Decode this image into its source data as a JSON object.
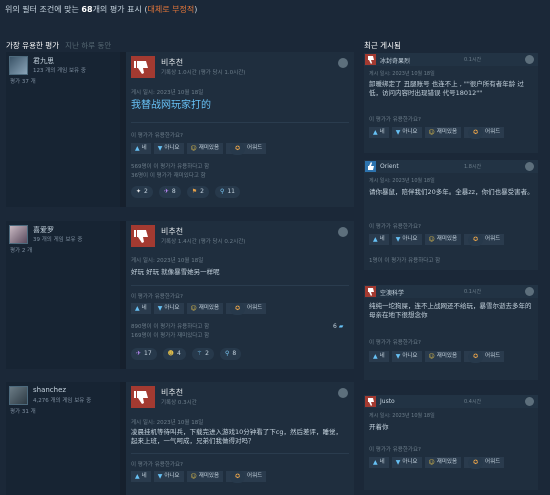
{
  "summary": {
    "prefix": "위의 필터 조건에 맞는 ",
    "count": "68",
    "middle": "개의 평가 표시 (",
    "sentiment": "대체로 부정적",
    "suffix": ")"
  },
  "left_header": {
    "active": "가장 유용한 평가",
    "sub": "지난 하루 동안"
  },
  "vote_labels": {
    "yes": "네",
    "no": "아니요",
    "funny": "재미있음",
    "award": "어워드"
  },
  "helpful_question": "이 평가가 유용한가요?",
  "reviews": [
    {
      "user": "君九思",
      "games": "123 개의 게임 보유 중",
      "review_count": "평가 37 개",
      "verdict": "비추천",
      "hours": "기록상 1.0시간 (평가 당시 1.0시간)",
      "posted": "게시 일시: 2023년 10월 18일",
      "text": "我替战网玩家打的",
      "stats": [
        "569명이 이 평가가 유용하다고 함",
        "36명이 이 평가가 재미있다고 함"
      ],
      "awards": [
        {
          "icon": "✦",
          "color": "#e8e8e8",
          "count": "2"
        },
        {
          "icon": "✈",
          "color": "#c18cff",
          "count": "8"
        },
        {
          "icon": "⚑",
          "color": "#e3a04a",
          "count": "2"
        },
        {
          "icon": "⚲",
          "color": "#7fd0ff",
          "count": "11"
        }
      ],
      "comments": ""
    },
    {
      "user": "喜爱罗",
      "games": "39 개의 게임 보유 중",
      "review_count": "평가 2 개",
      "verdict": "비추천",
      "hours": "기록상 1.4시간 (평가 당시 0.2시간)",
      "posted": "게시 일시: 2023년 10월 18일",
      "text": "好玩 好玩 就像暴雪她另一样呢",
      "stats": [
        "890명이 이 평가가 유용하다고 함",
        "169명이 이 평가가 재미있다고 함"
      ],
      "awards": [
        {
          "icon": "✈",
          "color": "#c18cff",
          "count": "17"
        },
        {
          "icon": "☻",
          "color": "#e3c04a",
          "count": "4"
        },
        {
          "icon": "⚚",
          "color": "#7fd0ff",
          "count": "2"
        },
        {
          "icon": "⚲",
          "color": "#7fd0ff",
          "count": "8"
        }
      ],
      "comments": "6"
    },
    {
      "user": "shanchez",
      "games": "4,276 개의 게임 보유 중",
      "review_count": "평가 31 개",
      "verdict": "비추천",
      "hours": "기록상 0.3시간",
      "posted": "게시 일시: 2023년 10월 18일",
      "text": "凌晨挂机等待叫兵，下载完进入游戏10分钟看了下cg，然后差评，睡觉，起来上班，一气呵成，兄弟们我做得对吗？",
      "stats": [],
      "awards": [],
      "comments": ""
    }
  ],
  "right_header": "최근 게시됨",
  "recent": [
    {
      "type": "down",
      "user": "冰封奇果烈",
      "time": "0.1시간",
      "posted": "게시 일시: 2023년 10월 18일",
      "text": "卸暖绑定了 丑腿账号 也连不上 , \"\"很户所有者年龄 过低，访问内容时出现错误 代号18012\"\"",
      "stat": ""
    },
    {
      "type": "up",
      "user": "Orient",
      "time": "1.8시간",
      "posted": "게시 일시: 2023년 10월 18일",
      "text": "请你暴鼠，陪伴我们20多年。全暴zz，你们也暴受害者。",
      "stat": "1명이 이 평가가 유용하다고 함"
    },
    {
      "type": "down",
      "user": "空澳科学",
      "time": "0.1시간",
      "posted": "",
      "text": "纯纯一坨狗屎，连不上战网还不给玩，暴雪尔逝去多年的母亲在地下很想念你",
      "stat": ""
    },
    {
      "type": "down",
      "user": "Justo",
      "time": "0.4시간",
      "posted": "게시 일시: 2023년 10월 18일",
      "text": "开着你",
      "stat": ""
    }
  ]
}
